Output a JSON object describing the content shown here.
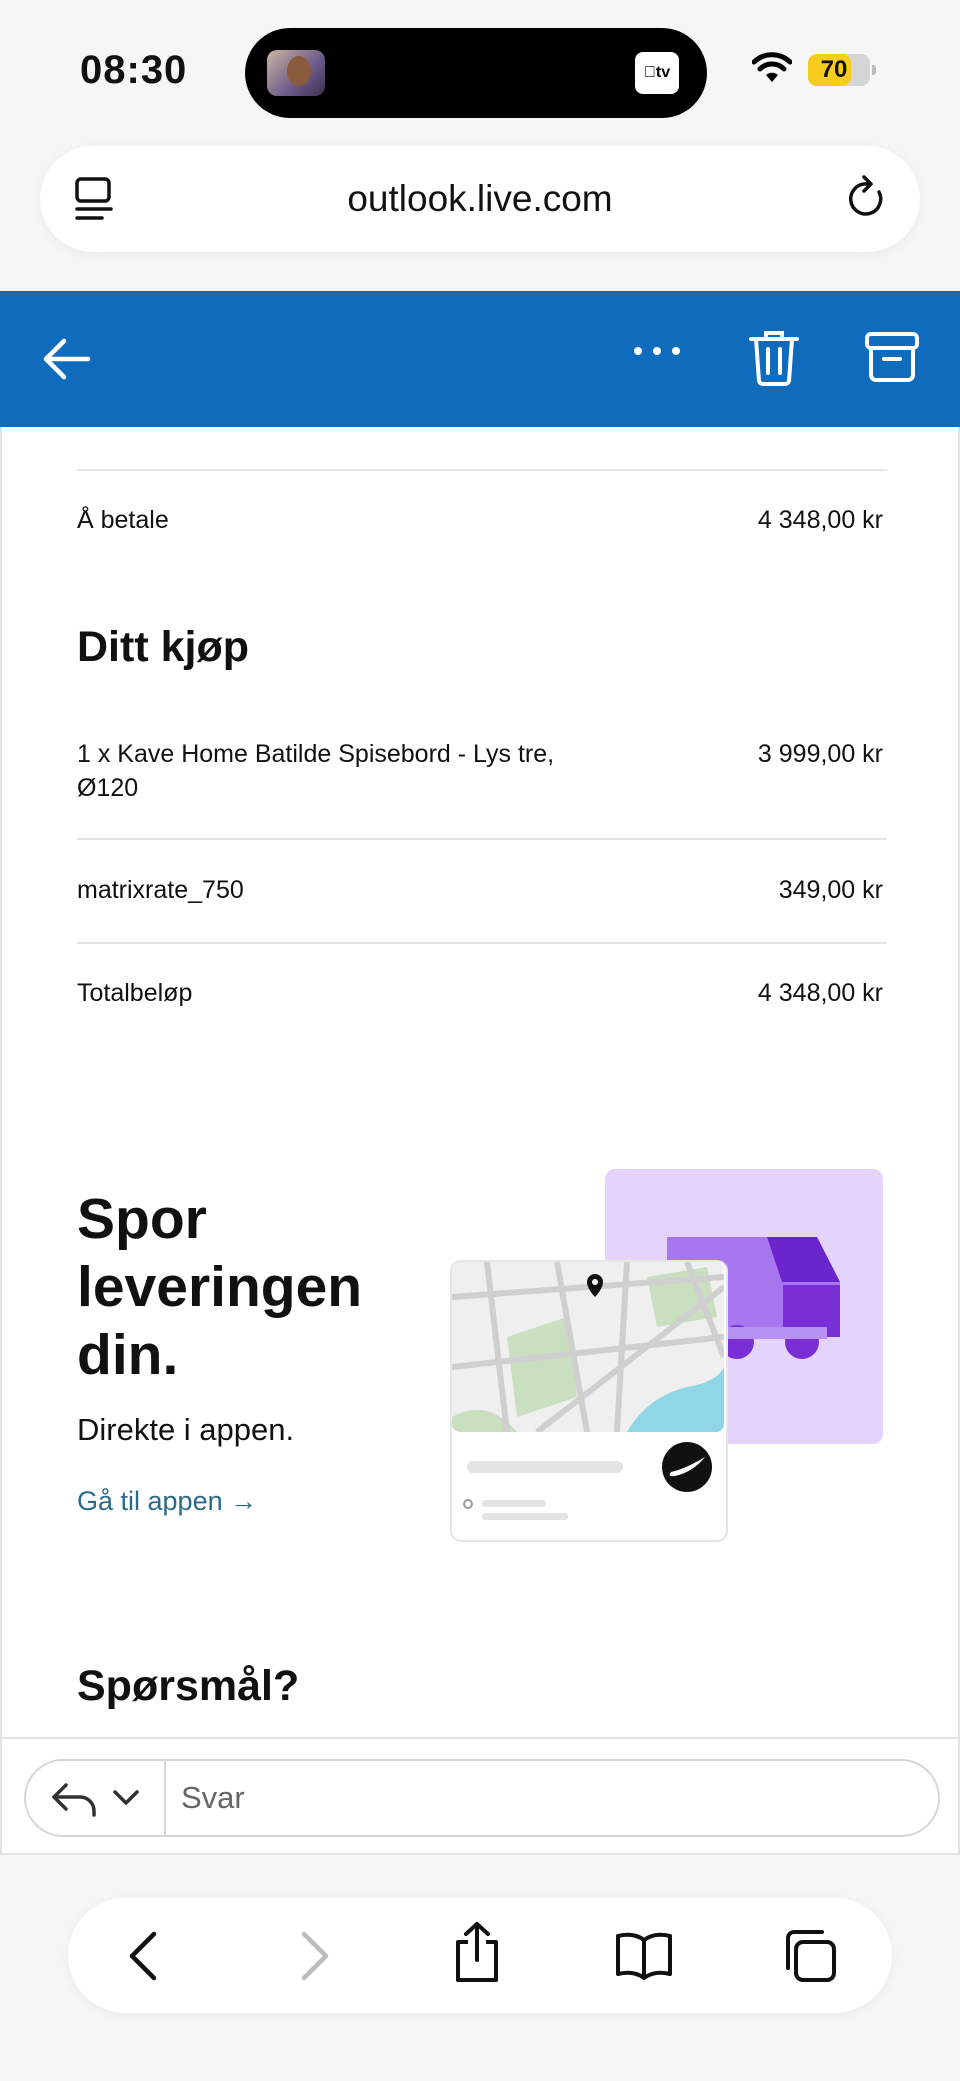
{
  "status": {
    "time": "08:30",
    "battery": "70",
    "battery_level": 0.7,
    "tv_badge": "tv"
  },
  "browser": {
    "url": "outlook.live.com"
  },
  "summary": {
    "to_pay_label": "Å betale",
    "to_pay_value": "4 348,00 kr"
  },
  "purchase": {
    "title": "Ditt kjøp",
    "items": [
      {
        "label_line1": "1 x Kave Home Batilde Spisebord - Lys tre,",
        "label_line2": "Ø120",
        "value": "3 999,00 kr"
      },
      {
        "label": "matrixrate_750",
        "value": "349,00 kr"
      }
    ],
    "total_label": "Totalbeløp",
    "total_value": "4 348,00 kr"
  },
  "promo": {
    "title_line1": "Spor",
    "title_line2": "leveringen",
    "title_line3": "din.",
    "subtitle": "Direkte i appen.",
    "link": "Gå til appen →"
  },
  "questions": {
    "title": "Spørsmål?"
  },
  "reply": {
    "placeholder": "Svar"
  },
  "colors": {
    "header_blue": "#0f6cbd",
    "link": "#2b6a8c",
    "purple": "#7a2fd6",
    "battery": "#f6cd1e"
  }
}
